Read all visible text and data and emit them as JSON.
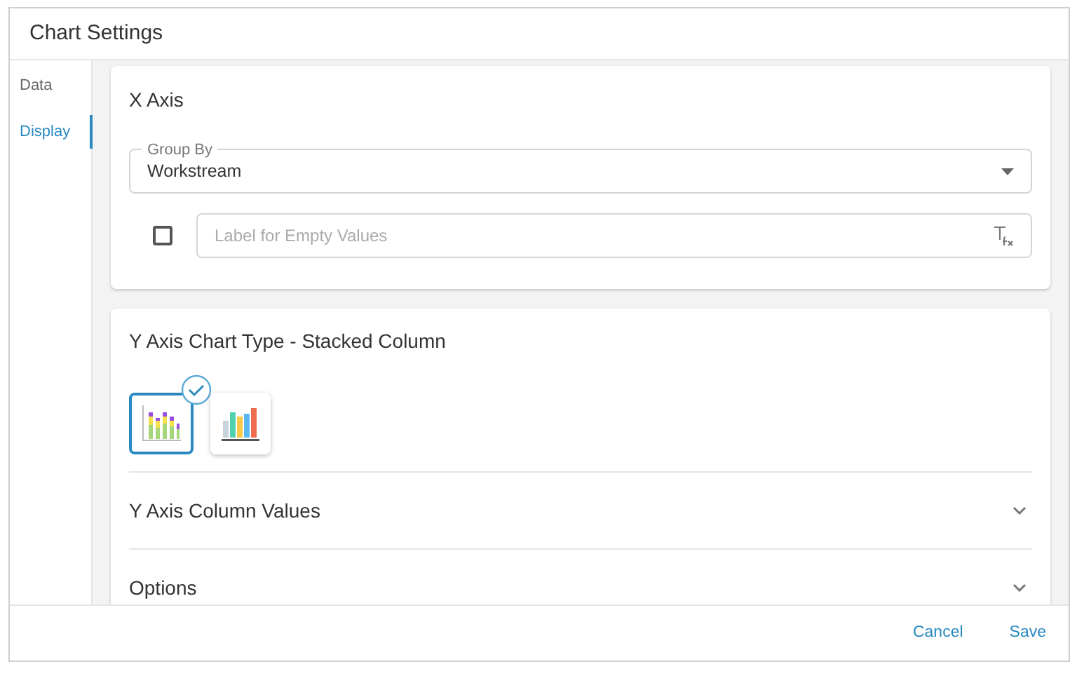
{
  "window": {
    "title": "Chart Settings"
  },
  "sidebar": {
    "items": [
      {
        "label": "Data",
        "selected": false
      },
      {
        "label": "Display",
        "selected": true
      }
    ]
  },
  "x_axis": {
    "title": "X Axis",
    "group_by": {
      "label": "Group By",
      "value": "Workstream"
    },
    "empty_label": {
      "checked": false,
      "placeholder": "Label for Empty Values"
    }
  },
  "y_axis": {
    "title": "Y Axis Chart Type - Stacked Column",
    "chart_types": [
      {
        "kind": "stacked",
        "selected": true
      },
      {
        "kind": "column",
        "selected": false
      }
    ],
    "sections": [
      {
        "label": "Y Axis Column Values",
        "expanded": false
      },
      {
        "label": "Options",
        "expanded": false
      }
    ]
  },
  "buttons": [
    "Cancel",
    "Save"
  ]
}
